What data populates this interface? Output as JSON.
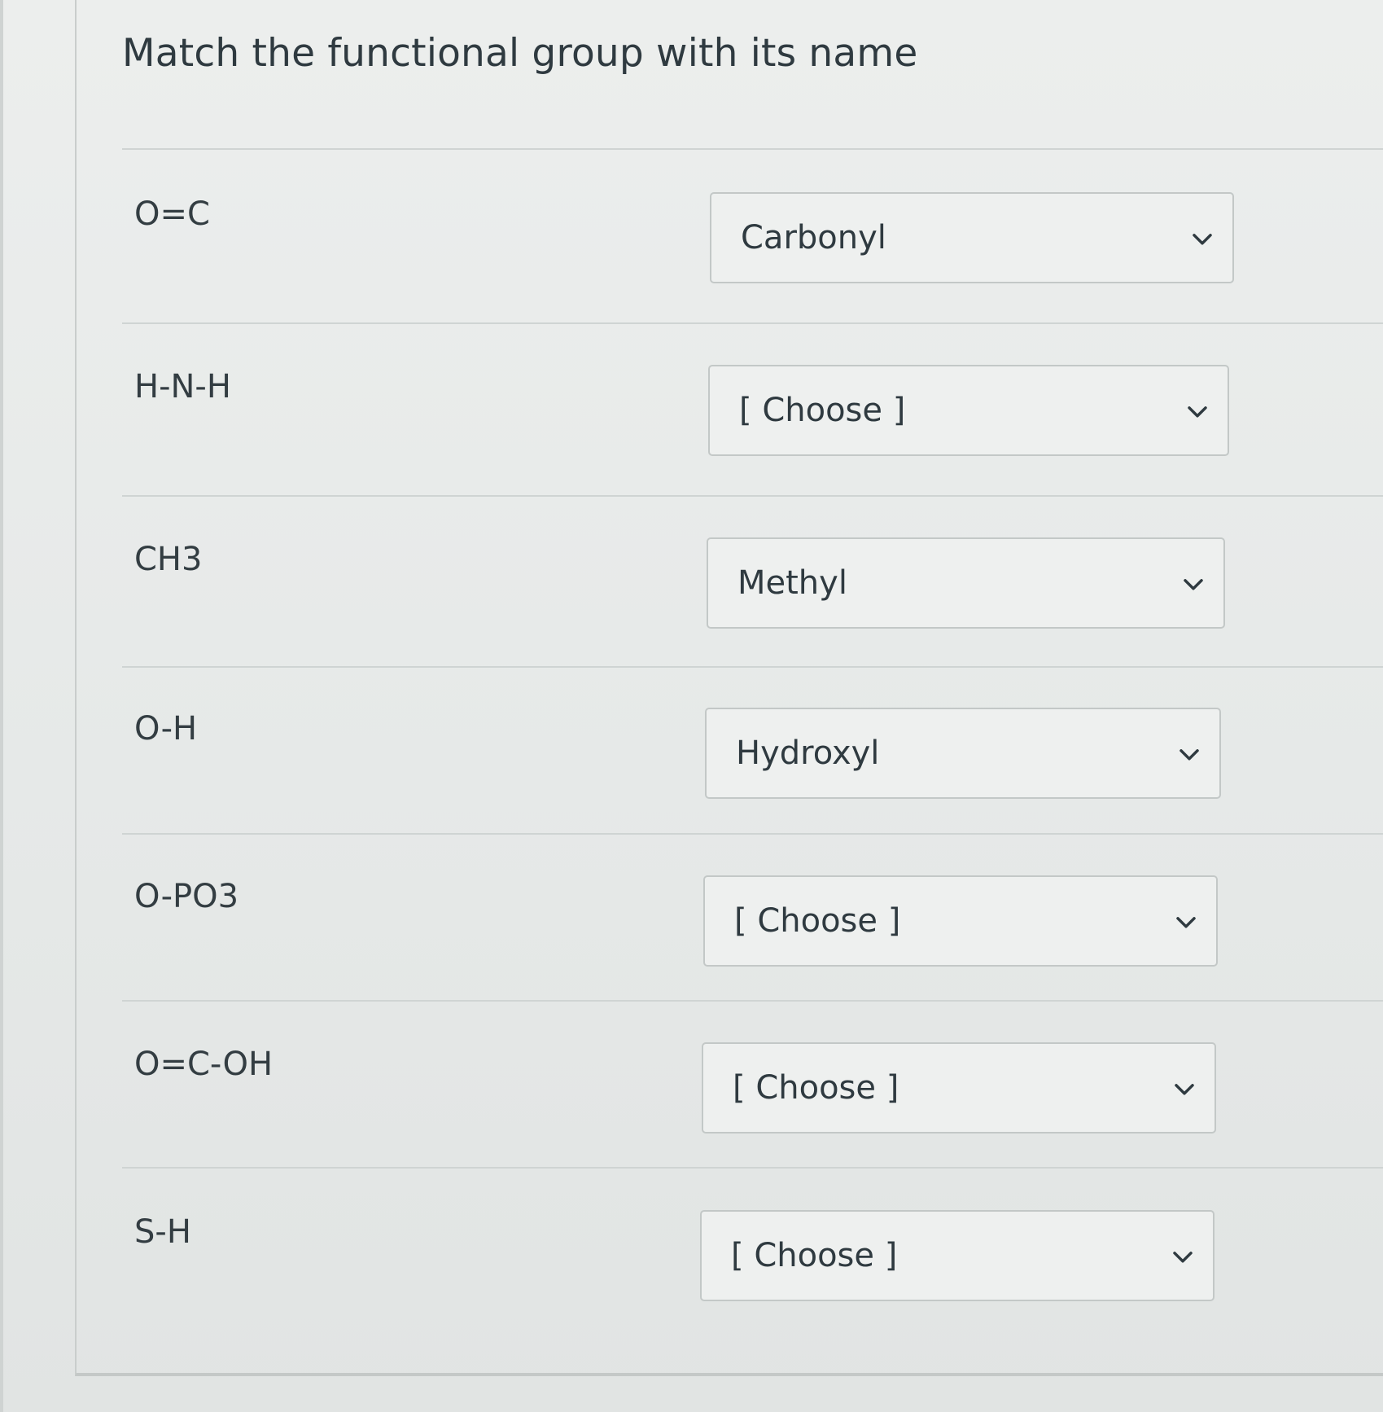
{
  "question": {
    "title": "Match the functional group with its name"
  },
  "rows": [
    {
      "term": "O=C",
      "selected": "Carbonyl"
    },
    {
      "term": "H-N-H",
      "selected": "[ Choose ]"
    },
    {
      "term": "CH3",
      "selected": "Methyl"
    },
    {
      "term": "O-H",
      "selected": "Hydroxyl"
    },
    {
      "term": "O-PO3",
      "selected": "[ Choose ]"
    },
    {
      "term": "O=C-OH",
      "selected": "[ Choose ]"
    },
    {
      "term": "S-H",
      "selected": "[ Choose ]"
    }
  ],
  "icons": {
    "dropdown": "chevron-down-icon"
  },
  "colors": {
    "text": "#2f3a40",
    "border": "#c3c8c7",
    "background": "#e9ebea"
  }
}
